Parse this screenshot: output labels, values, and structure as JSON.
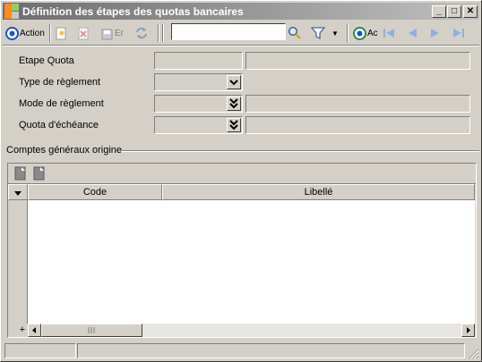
{
  "window": {
    "title": "Définition des étapes des quotas bancaires",
    "minimize_glyph": "_",
    "maximize_glyph": "□",
    "close_glyph": "✕"
  },
  "toolbar": {
    "actions_label": "Action",
    "new_icon": "new-document-icon",
    "delete_icon": "delete-icon",
    "save_label": "Er",
    "refresh_icon": "refresh-icon",
    "search_value": "",
    "search_icon": "magnifier-icon",
    "filter_icon": "funnel-icon",
    "filter_dropdown": "▼",
    "secondary_label": "Ac",
    "nav": [
      "first",
      "previous",
      "next",
      "last"
    ]
  },
  "form": {
    "etape_quota_label": "Etape Quota",
    "type_reglement_label": "Type de règlement",
    "mode_reglement_label": "Mode de règlement",
    "quota_echeance_label": "Quota d'échéance"
  },
  "grid": {
    "group_label": "Comptes généraux origine",
    "columns": [
      "Code",
      "Libellé"
    ],
    "rows": [],
    "add_glyph": "+"
  },
  "colors": {
    "window_bg": "#d4d0c8",
    "title_gradient_start": "#6d6d6d",
    "accent_blue": "#1e50c8",
    "nav_blue": "#5b8fe0"
  }
}
